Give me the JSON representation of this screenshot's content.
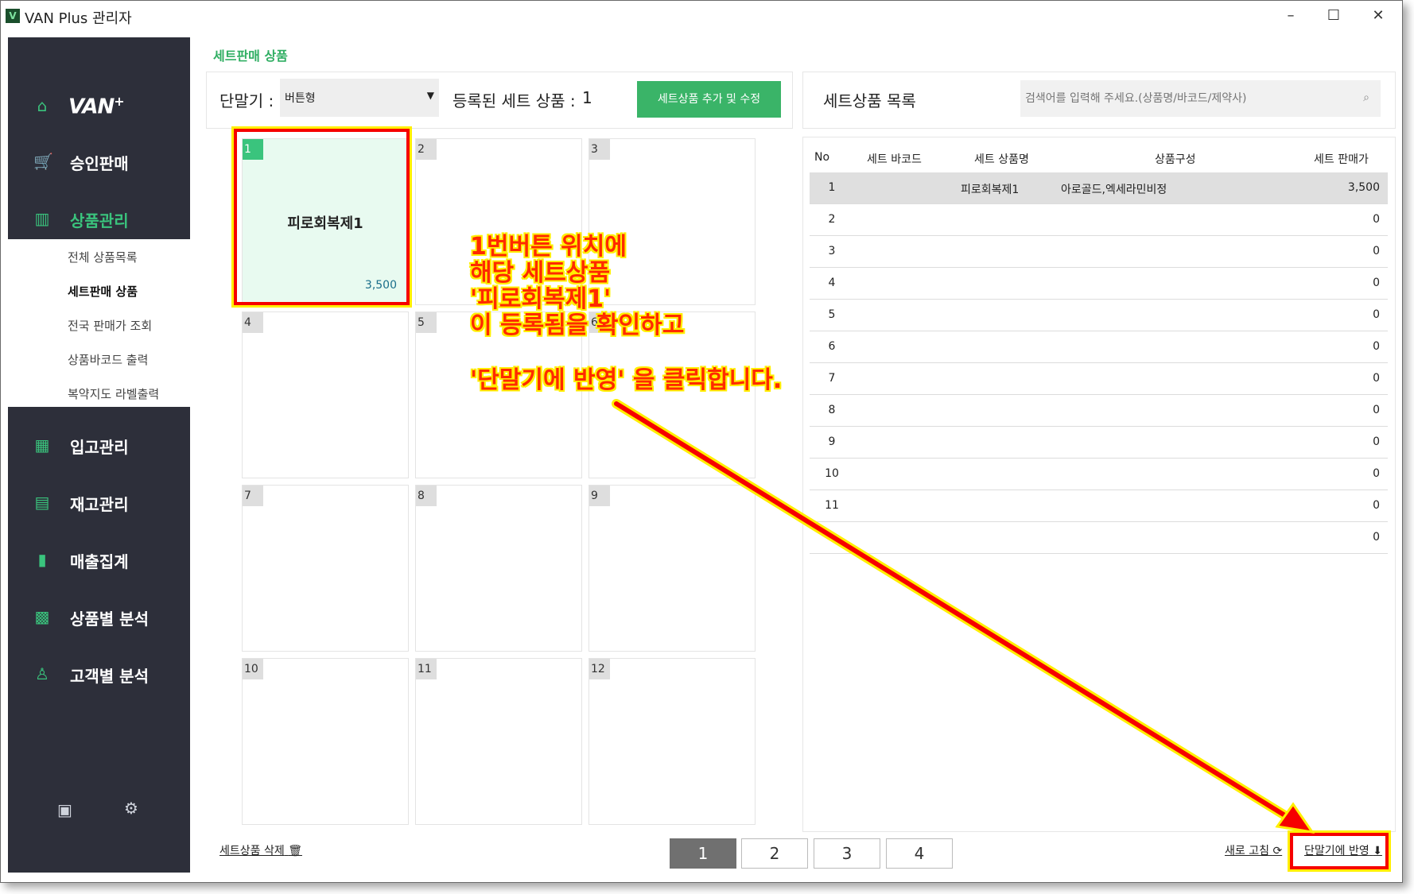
{
  "window": {
    "title": "VAN Plus 관리자",
    "minimize": "–",
    "maximize": "☐",
    "close": "✕"
  },
  "sidebar": {
    "logo": "VAN",
    "logo_sup": "+",
    "items": [
      {
        "label": "승인판매",
        "icon": "cart-icon"
      },
      {
        "label": "상품관리",
        "icon": "barcode-icon"
      },
      {
        "label": "입고관리",
        "icon": "calculator-icon"
      },
      {
        "label": "재고관리",
        "icon": "list-icon"
      },
      {
        "label": "매출집계",
        "icon": "bar-chart-icon"
      },
      {
        "label": "상품별 분석",
        "icon": "analysis-icon"
      },
      {
        "label": "고객별 분석",
        "icon": "user-icon"
      }
    ],
    "submenu": [
      "전체 상품목록",
      "세트판매 상품",
      "전국 판매가 조회",
      "상품바코드 출력",
      "복약지도 라벨출력"
    ]
  },
  "main": {
    "page_title": "세트판매 상품",
    "terminal_label": "단말기 :",
    "terminal_value": "버튼형",
    "registered_label": "등록된 세트 상품 :",
    "registered_count": "1",
    "add_button": "세트상품 추가 및 수정",
    "grid": [
      {
        "num": "1",
        "name": "피로회복제1",
        "price": "3,500"
      },
      {
        "num": "2",
        "name": "",
        "price": ""
      },
      {
        "num": "3",
        "name": "",
        "price": ""
      },
      {
        "num": "4",
        "name": "",
        "price": ""
      },
      {
        "num": "5",
        "name": "",
        "price": ""
      },
      {
        "num": "6",
        "name": "",
        "price": ""
      },
      {
        "num": "7",
        "name": "",
        "price": ""
      },
      {
        "num": "8",
        "name": "",
        "price": ""
      },
      {
        "num": "9",
        "name": "",
        "price": ""
      },
      {
        "num": "10",
        "name": "",
        "price": ""
      },
      {
        "num": "11",
        "name": "",
        "price": ""
      },
      {
        "num": "12",
        "name": "",
        "price": ""
      }
    ],
    "delete_link": "세트상품 삭제",
    "pages": [
      "1",
      "2",
      "3",
      "4"
    ]
  },
  "list_panel": {
    "title": "세트상품 목록",
    "search_placeholder": "검색어를 입력해 주세요.(상품명/바코드/제약사)",
    "columns": [
      "No",
      "세트 바코드",
      "세트 상품명",
      "상품구성",
      "세트 판매가"
    ],
    "rows": [
      {
        "no": "1",
        "name": "피로회복제1",
        "comp": "아로골드,엑세라민비정",
        "price": "3,500"
      },
      {
        "no": "2",
        "name": "",
        "comp": "",
        "price": "0"
      },
      {
        "no": "3",
        "name": "",
        "comp": "",
        "price": "0"
      },
      {
        "no": "4",
        "name": "",
        "comp": "",
        "price": "0"
      },
      {
        "no": "5",
        "name": "",
        "comp": "",
        "price": "0"
      },
      {
        "no": "6",
        "name": "",
        "comp": "",
        "price": "0"
      },
      {
        "no": "7",
        "name": "",
        "comp": "",
        "price": "0"
      },
      {
        "no": "8",
        "name": "",
        "comp": "",
        "price": "0"
      },
      {
        "no": "9",
        "name": "",
        "comp": "",
        "price": "0"
      },
      {
        "no": "10",
        "name": "",
        "comp": "",
        "price": "0"
      },
      {
        "no": "11",
        "name": "",
        "comp": "",
        "price": "0"
      },
      {
        "no": "",
        "name": "",
        "comp": "",
        "price": "0"
      }
    ],
    "refresh_link": "새로 고침",
    "reflect_link": "단말기에 반영"
  },
  "annotation": {
    "line1": "1번버튼 위치에",
    "line2": "해당 세트상품",
    "line3": "'피로회복제1'",
    "line4": "이 등록됨을 확인하고",
    "line5": "'단말기에 반영' 을 클릭합니다."
  },
  "colors": {
    "accent": "#3ac47d",
    "sidebar": "#2d2f3a",
    "annotation": "#ff2a00",
    "highlight": "#ffef00"
  }
}
